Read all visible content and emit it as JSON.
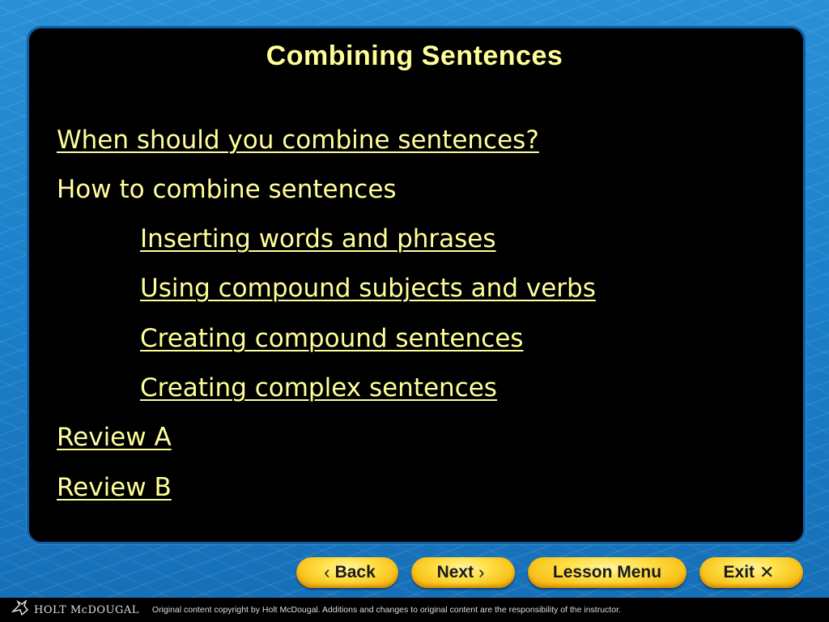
{
  "slide": {
    "title": "Combining Sentences",
    "items": [
      {
        "label": "When should you combine sentences?",
        "link": true,
        "indent": 0
      },
      {
        "label": "How to combine sentences",
        "link": false,
        "indent": 0
      },
      {
        "label": "Inserting words and phrases",
        "link": true,
        "indent": 1
      },
      {
        "label": "Using compound subjects and verbs",
        "link": true,
        "indent": 1
      },
      {
        "label": "Creating compound sentences",
        "link": true,
        "indent": 1
      },
      {
        "label": "Creating complex sentences",
        "link": true,
        "indent": 1
      },
      {
        "label": "Review A",
        "link": true,
        "indent": 0
      },
      {
        "label": "Review B",
        "link": true,
        "indent": 0
      }
    ],
    "text_color": "#FFFF99"
  },
  "nav": {
    "back": {
      "label": "Back",
      "icon": "chevron-left-icon",
      "glyph": "‹"
    },
    "next": {
      "label": "Next",
      "icon": "chevron-right-icon",
      "glyph": "›"
    },
    "lesson_menu": {
      "label": "Lesson Menu"
    },
    "exit": {
      "label": "Exit",
      "icon": "close-icon",
      "glyph": "✕"
    }
  },
  "footer": {
    "brand": "HOLT McDOUGAL",
    "logo_icon": "holt-mcdougal-logo-icon",
    "copyright": "Original content copyright by Holt McDougal. Additions and changes to original content are the responsibility of the instructor."
  }
}
